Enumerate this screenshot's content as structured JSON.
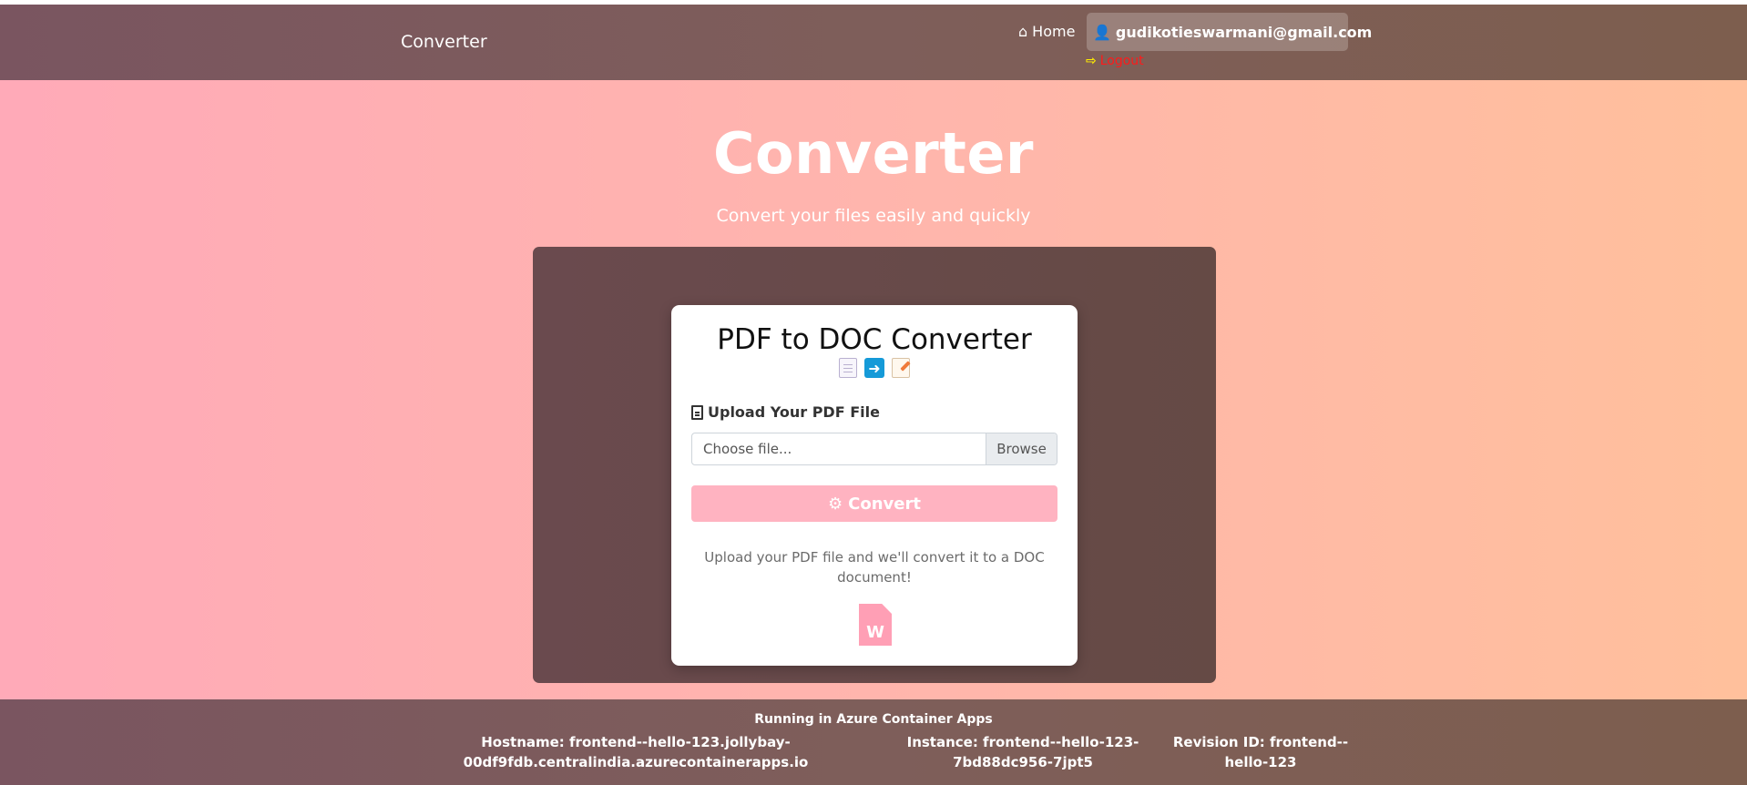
{
  "navbar": {
    "brand": "Converter",
    "home_label": "Home",
    "user_email": "gudikotieswarmani@gmail.com",
    "logout_label": "Logout"
  },
  "hero": {
    "title": "Converter",
    "subtitle": "Convert your files easily and quickly"
  },
  "card": {
    "title": "PDF to DOC Converter",
    "upload_label": "Upload Your PDF File",
    "file_placeholder": "Choose file...",
    "browse_label": "Browse",
    "convert_label": "Convert",
    "help_text": "Upload your PDF file and we'll convert it to a DOC document!",
    "word_letter": "W"
  },
  "footer": {
    "title": "Running in Azure Container Apps",
    "hostname_line1": "Hostname: frontend--hello-123.jollybay-",
    "hostname_line2": "00df9fdb.centralindia.azurecontainerapps.io",
    "instance_line1": "Instance: frontend--hello-123-",
    "instance_line2": "7bd88dc956-7jpt5",
    "revision_line1": "Revision ID: frontend--",
    "revision_line2": "hello-123"
  },
  "colors": {
    "accent_pink": "#ffb3c1",
    "panel_brown": "#654a45",
    "logout_red": "#ff1a1a"
  },
  "icons": {
    "home": "home-icon",
    "user": "user-icon",
    "logout": "logout-icon",
    "pdf": "file-pdf-icon",
    "gear": "gears-icon",
    "word": "file-word-icon"
  }
}
